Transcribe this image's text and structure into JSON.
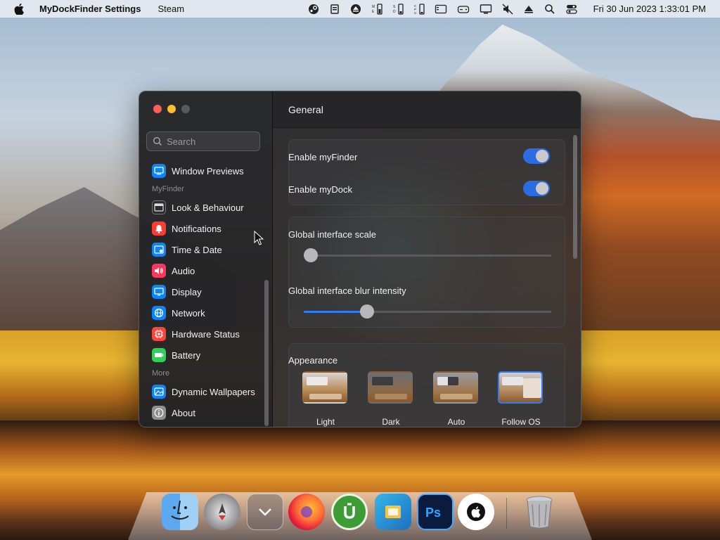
{
  "menubar": {
    "app_name": "MyDockFinder Settings",
    "menu_item": "Steam",
    "clock": "Fri 30 Jun 2023  1:33:01 PM"
  },
  "search": {
    "placeholder": "Search"
  },
  "sidebar": {
    "top_item": "Window Previews",
    "group_myfinder": "MyFinder",
    "items": [
      {
        "label": "Look & Behaviour",
        "icon": "window-icon",
        "color": "#3a3a3c"
      },
      {
        "label": "Notifications",
        "icon": "bell-icon",
        "color": "#ff3b30"
      },
      {
        "label": "Time & Date",
        "icon": "clock-icon",
        "color": "#0a84ff"
      },
      {
        "label": "Audio",
        "icon": "speaker-icon",
        "color": "#ff375f"
      },
      {
        "label": "Display",
        "icon": "monitor-icon",
        "color": "#0a84ff"
      },
      {
        "label": "Network",
        "icon": "globe-icon",
        "color": "#0a84ff"
      },
      {
        "label": "Hardware Status",
        "icon": "chip-icon",
        "color": "#ff453a"
      },
      {
        "label": "Battery",
        "icon": "battery-icon",
        "color": "#30d158"
      }
    ],
    "group_more": "More",
    "more_items": [
      {
        "label": "Dynamic Wallpapers",
        "icon": "wallpaper-icon",
        "color": "#0a84ff"
      },
      {
        "label": "About",
        "icon": "info-icon",
        "color": "#8e8e93"
      }
    ]
  },
  "main": {
    "title": "General",
    "enable_finder": "Enable myFinder",
    "enable_dock": "Enable myDock",
    "scale_label": "Global interface scale",
    "scale_value": 0,
    "blur_label": "Global interface blur intensity",
    "blur_value": 0.24,
    "appearance_title": "Appearance",
    "appearance_options": [
      "Light",
      "Dark",
      "Auto",
      "Follow OS"
    ],
    "appearance_selected": "Follow OS"
  },
  "colors": {
    "accent": "#2f7bef",
    "close": "#ff5f57",
    "minimize": "#febc2e",
    "zoom": "#5a5a5c"
  },
  "dock": {
    "apps": [
      "finder-icon",
      "launchpad-icon",
      "downloads-icon",
      "firefox-icon",
      "utorrent-icon",
      "file-manager-icon",
      "photoshop-icon",
      "apple-icon",
      "trash-icon"
    ]
  }
}
